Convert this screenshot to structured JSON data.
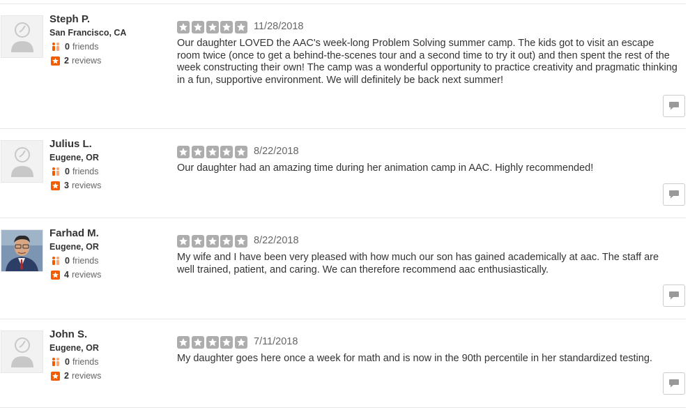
{
  "reviews": [
    {
      "user": {
        "name": "Steph P.",
        "location": "San Francisco, CA",
        "friends_count": "0",
        "friends_label": "friends",
        "reviews_count": "2",
        "reviews_label": "reviews"
      },
      "rating": 5,
      "date": "11/28/2018",
      "text": "Our daughter LOVED the AAC's week-long Problem Solving summer camp.  The kids got to visit an escape room twice (once to get a behind-the-scenes tour and a second time to try it out) and then spent the rest of the week constructing their own! The camp was a wonderful opportunity to practice creativity and pragmatic thinking in a fun, supportive environment.  We will definitely be back next summer!"
    },
    {
      "user": {
        "name": "Julius L.",
        "location": "Eugene, OR",
        "friends_count": "0",
        "friends_label": "friends",
        "reviews_count": "3",
        "reviews_label": "reviews"
      },
      "rating": 5,
      "date": "8/22/2018",
      "text": "Our daughter had an amazing time during her animation camp in AAC. Highly recommended!"
    },
    {
      "user": {
        "name": "Farhad M.",
        "location": "Eugene, OR",
        "friends_count": "0",
        "friends_label": "friends",
        "reviews_count": "4",
        "reviews_label": "reviews"
      },
      "rating": 5,
      "date": "8/22/2018",
      "text": "My wife and I have been very pleased with how much our son has gained academically at aac. The staff are well trained, patient, and caring. We can therefore recommend aac enthusiastically."
    },
    {
      "user": {
        "name": "John S.",
        "location": "Eugene, OR",
        "friends_count": "0",
        "friends_label": "friends",
        "reviews_count": "2",
        "reviews_label": "reviews"
      },
      "rating": 5,
      "date": "7/11/2018",
      "text": "My daughter goes here once a week for math and is now in the 90th percentile in her standardized testing."
    }
  ],
  "colors": {
    "star_unlit": "#adadad",
    "accent_orange": "#f15c00",
    "divider": "#e6e6e6"
  },
  "icons": {
    "friends": "friends-icon",
    "reviews": "review-star-icon",
    "comment": "speech-bubble-icon",
    "avatar_default": "default-avatar-icon"
  }
}
